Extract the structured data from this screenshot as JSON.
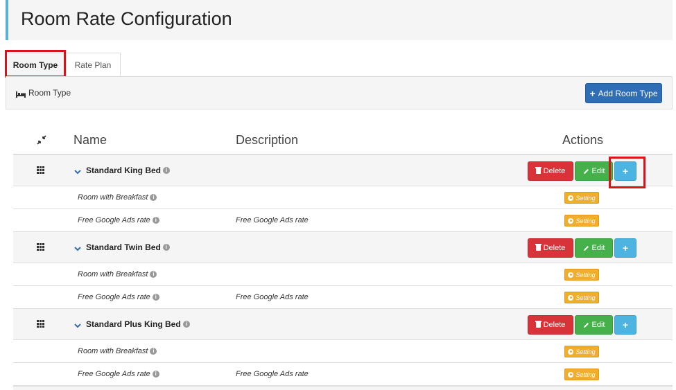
{
  "page": {
    "title": "Room Rate Configuration"
  },
  "tabs": [
    {
      "label": "Room Type",
      "active": true
    },
    {
      "label": "Rate Plan",
      "active": false
    }
  ],
  "panel": {
    "title": "Room Type",
    "add_button": "Add Room Type"
  },
  "table": {
    "headers": {
      "name": "Name",
      "description": "Description",
      "actions": "Actions"
    },
    "button_labels": {
      "delete": "Delete",
      "edit": "Edit",
      "plus": "+",
      "setting": "Setting"
    },
    "groups": [
      {
        "name": "Standard King Bed",
        "rates": [
          {
            "name": "Room with Breakfast",
            "description": ""
          },
          {
            "name": "Free Google Ads rate",
            "description": "Free Google Ads rate"
          }
        ]
      },
      {
        "name": "Standard Twin Bed",
        "rates": [
          {
            "name": "Room with Breakfast",
            "description": ""
          },
          {
            "name": "Free Google Ads rate",
            "description": "Free Google Ads rate"
          }
        ]
      },
      {
        "name": "Standard Plus King Bed",
        "rates": [
          {
            "name": "Room with Breakfast",
            "description": ""
          },
          {
            "name": "Free Google Ads rate",
            "description": "Free Google Ads rate"
          }
        ]
      }
    ]
  },
  "colors": {
    "primary": "#2f6db5",
    "delete": "#d9333a",
    "edit": "#46b04a",
    "plus": "#4db3e0",
    "setting": "#f0ad2e",
    "highlight": "#d7141a",
    "header_accent": "#5bb0d9"
  },
  "icons": {
    "panel": "bed-icon",
    "collapse": "compress-icon",
    "drag": "grip-icon",
    "expand": "chevron-down-icon",
    "info": "info-icon",
    "delete": "trash-icon",
    "edit": "pencil-icon",
    "setting": "gear-icon",
    "add": "plus-icon"
  }
}
